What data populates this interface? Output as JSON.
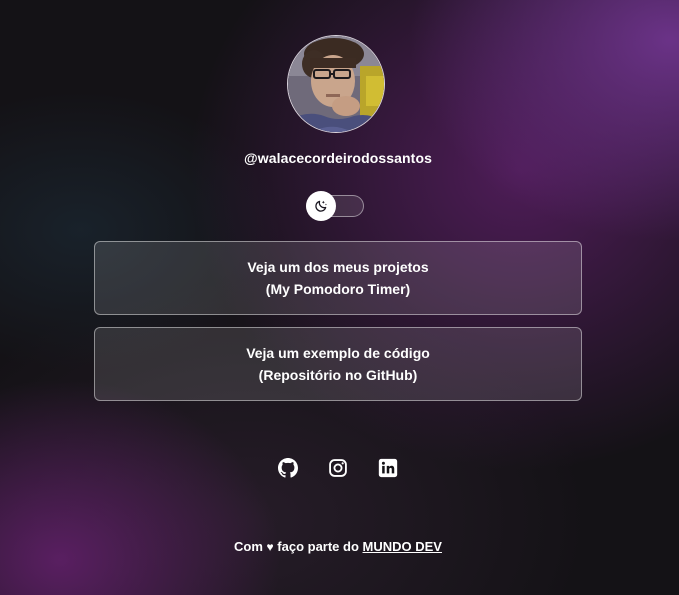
{
  "profile": {
    "username": "@walacecordeirodossantos"
  },
  "theme_toggle": {
    "icon": "moon-icon",
    "state": "dark"
  },
  "links": [
    {
      "line1": "Veja um dos meus projetos",
      "line2": "(My Pomodoro Timer)"
    },
    {
      "line1": "Veja um exemplo de código",
      "line2": "(Repositório no GitHub)"
    }
  ],
  "socials": [
    {
      "icon": "github-icon"
    },
    {
      "icon": "instagram-icon"
    },
    {
      "icon": "linkedin-icon"
    }
  ],
  "footer": {
    "prefix": "Com",
    "heart": "♥",
    "middle": "faço parte do",
    "link_text": "MUNDO DEV"
  },
  "colors": {
    "accent_purple": "#6e348c",
    "background_dark": "#141216",
    "text": "#ffffff"
  }
}
